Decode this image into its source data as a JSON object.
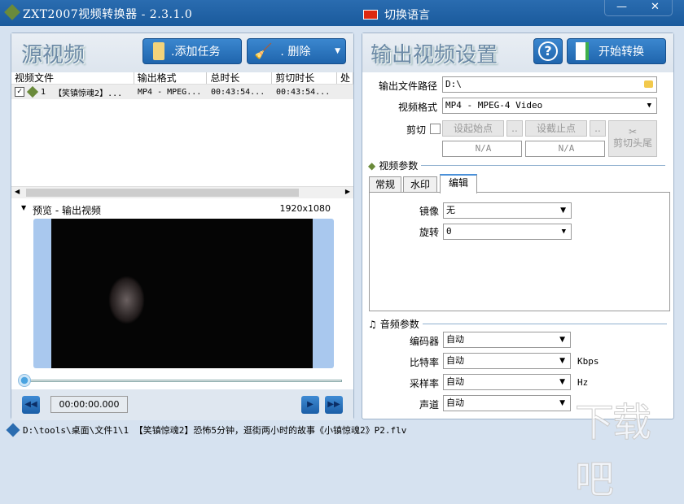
{
  "window": {
    "title": "ZXT2007视频转换器 - 2.3.1.0",
    "language_button": "切换语言",
    "minimize": "—",
    "close": "✕"
  },
  "source": {
    "title": "源视频",
    "add_task": ".添加任务",
    "delete": ".   删除",
    "columns": [
      "视频文件",
      "输出格式",
      "总时长",
      "剪切时长",
      "处"
    ],
    "rows": [
      {
        "index": "1",
        "name": "【笑镇惊魂2】...",
        "format": "MP4 - MPEG...",
        "total": "00:43:54...",
        "cut": "00:43:54...",
        "checked": true
      }
    ]
  },
  "preview": {
    "label": "预览 - 输出视频",
    "resolution": "1920x1080",
    "time": "00:00:00.000",
    "progress": 0
  },
  "output": {
    "title": "输出视频设置",
    "start": "开始转换",
    "help": "?",
    "path_label": "输出文件路径",
    "path_value": "D:\\",
    "format_label": "视频格式",
    "format_value": "MP4 - MPEG-4 Video",
    "cut_label": "剪切",
    "set_start": "设起始点",
    "set_end": "设截止点",
    "dots": "..",
    "start_value": "N/A",
    "end_value": "N/A",
    "cut_ends": "剪切头尾"
  },
  "video_params": {
    "title": "视频参数",
    "tabs": [
      "常规",
      "水印",
      "编辑"
    ],
    "active_tab": 2,
    "mirror_label": "镜像",
    "mirror_value": "无",
    "rotate_label": "旋转",
    "rotate_value": "0"
  },
  "audio_params": {
    "title": "音频参数",
    "encoder_label": "编码器",
    "encoder_value": "自动",
    "bitrate_label": "比特率",
    "bitrate_value": "自动",
    "bitrate_unit": "Kbps",
    "samplerate_label": "采样率",
    "samplerate_value": "自动",
    "samplerate_unit": "Hz",
    "channel_label": "声道",
    "channel_value": "自动"
  },
  "status": {
    "text": "D:\\tools\\桌面\\文件1\\1 【笑镇惊魂2】恐怖5分钟，逛街两小时的故事《小镇惊魂2》P2.flv"
  },
  "watermark": "下载吧"
}
